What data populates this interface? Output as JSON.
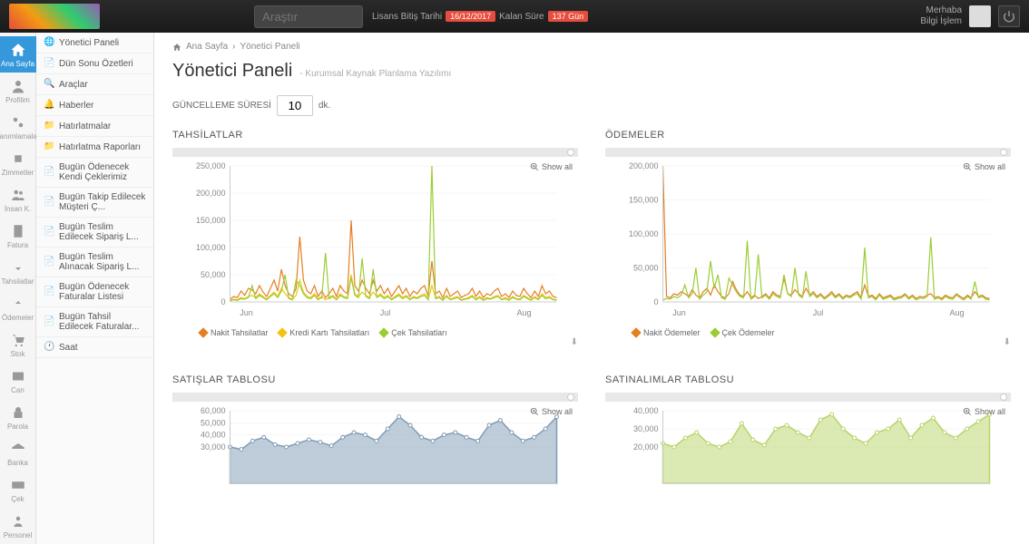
{
  "header": {
    "search_placeholder": "Araştır",
    "license_label": "Lisans Bitiş Tarihi",
    "license_date": "16/12/2017",
    "remaining_label": "Kalan Süre",
    "remaining_value": "137 Gün",
    "greeting": "Merhaba",
    "user_name": "Bilgi İşlem"
  },
  "icon_nav": [
    {
      "id": "home",
      "label": "Ana Sayfa"
    },
    {
      "id": "profile",
      "label": "Profilim"
    },
    {
      "id": "defs",
      "label": "Tanımlamalar"
    },
    {
      "id": "zimmet",
      "label": "Zimmetler"
    },
    {
      "id": "insan",
      "label": "İnsan K."
    },
    {
      "id": "fatura",
      "label": "Fatura"
    },
    {
      "id": "tahsilat",
      "label": "Tahsilatlar"
    },
    {
      "id": "odeme",
      "label": "Ödemeler"
    },
    {
      "id": "stok",
      "label": "Stok"
    },
    {
      "id": "can",
      "label": "Can"
    },
    {
      "id": "parola",
      "label": "Parola"
    },
    {
      "id": "banka",
      "label": "Banka"
    },
    {
      "id": "cek",
      "label": "Çek"
    },
    {
      "id": "personel",
      "label": "Personel"
    }
  ],
  "menu": [
    {
      "label": "Yönetici Paneli",
      "icon": "globe"
    },
    {
      "label": "Dün Sonu Özetleri",
      "icon": "doc"
    },
    {
      "label": "Araçlar",
      "icon": "search"
    },
    {
      "label": "Haberler",
      "icon": "bell"
    },
    {
      "label": "Hatırlatmalar",
      "icon": "folder"
    },
    {
      "label": "Hatırlatma Raporları",
      "icon": "folder"
    },
    {
      "label": "Bugün Ödenecek Kendi Çeklerimiz",
      "icon": "doc"
    },
    {
      "label": "Bugün Takip Edilecek Müşteri Ç...",
      "icon": "doc"
    },
    {
      "label": "Bugün Teslim Edilecek Sipariş L...",
      "icon": "doc"
    },
    {
      "label": "Bugün Teslim Alınacak Sipariş L...",
      "icon": "doc"
    },
    {
      "label": "Bugün Ödenecek Faturalar Listesi",
      "icon": "doc"
    },
    {
      "label": "Bugün Tahsil Edilecek Faturalar...",
      "icon": "doc"
    },
    {
      "label": "Saat",
      "icon": "clock"
    }
  ],
  "breadcrumb": {
    "home": "Ana Sayfa",
    "current": "Yönetici Paneli"
  },
  "page": {
    "title": "Yönetici Paneli",
    "subtitle": "- Kurumsal Kaynak Planlama Yazılımı"
  },
  "refresh": {
    "label": "GÜNCELLEME SÜRESİ",
    "value": "10",
    "unit": "dk."
  },
  "chart_titles": {
    "tahsilatlar": "TAHSİLATLAR",
    "odemeler": "ÖDEMELER",
    "satislar": "SATIŞLAR TABLOSU",
    "satinalim": "SATINALIMLAR TABLOSU"
  },
  "show_all": "Show all",
  "chart_data": [
    {
      "id": "tahsilatlar",
      "type": "line",
      "xlabel": "",
      "ylabel": "",
      "ylim": [
        0,
        250000
      ],
      "yticks": [
        0,
        50000,
        100000,
        150000,
        200000,
        250000
      ],
      "xticks": [
        "Jun",
        "Jul",
        "Aug"
      ],
      "x_count": 90,
      "series": [
        {
          "name": "Nakit Tahsilatlar",
          "color": "#e67e22",
          "values": [
            5000,
            10000,
            8000,
            20000,
            12000,
            25000,
            22000,
            15000,
            30000,
            18000,
            10000,
            25000,
            40000,
            20000,
            60000,
            30000,
            15000,
            10000,
            25000,
            120000,
            40000,
            20000,
            15000,
            30000,
            10000,
            20000,
            8000,
            15000,
            25000,
            10000,
            30000,
            20000,
            15000,
            150000,
            30000,
            20000,
            40000,
            25000,
            15000,
            40000,
            20000,
            30000,
            15000,
            25000,
            10000,
            20000,
            30000,
            15000,
            25000,
            10000,
            20000,
            15000,
            25000,
            30000,
            10000,
            75000,
            15000,
            20000,
            8000,
            25000,
            10000,
            15000,
            20000,
            8000,
            12000,
            15000,
            25000,
            10000,
            20000,
            8000,
            15000,
            12000,
            20000,
            25000,
            10000,
            15000,
            8000,
            20000,
            12000,
            10000,
            25000,
            15000,
            8000,
            20000,
            10000,
            30000,
            15000,
            20000,
            10000,
            8000
          ]
        },
        {
          "name": "Kredi Kartı Tahsilatları",
          "color": "#f1c40f",
          "values": [
            3000,
            5000,
            4000,
            8000,
            6000,
            10000,
            12000,
            8000,
            15000,
            10000,
            5000,
            12000,
            18000,
            10000,
            25000,
            15000,
            8000,
            5000,
            12000,
            40000,
            18000,
            10000,
            8000,
            15000,
            5000,
            10000,
            4000,
            8000,
            12000,
            5000,
            15000,
            10000,
            8000,
            50000,
            15000,
            10000,
            18000,
            12000,
            8000,
            18000,
            10000,
            15000,
            8000,
            12000,
            5000,
            10000,
            15000,
            8000,
            12000,
            5000,
            10000,
            8000,
            12000,
            15000,
            5000,
            30000,
            8000,
            10000,
            4000,
            12000,
            5000,
            8000,
            10000,
            4000,
            6000,
            8000,
            12000,
            5000,
            10000,
            4000,
            8000,
            6000,
            10000,
            12000,
            5000,
            8000,
            4000,
            10000,
            6000,
            5000,
            12000,
            8000,
            4000,
            10000,
            5000,
            15000,
            8000,
            10000,
            5000,
            4000
          ]
        },
        {
          "name": "Çek Tahsilatları",
          "color": "#9acd32",
          "values": [
            2000,
            4000,
            3000,
            6000,
            5000,
            8000,
            30000,
            6000,
            12000,
            8000,
            4000,
            10000,
            15000,
            8000,
            20000,
            50000,
            6000,
            4000,
            40000,
            30000,
            15000,
            8000,
            6000,
            12000,
            4000,
            8000,
            90000,
            6000,
            10000,
            4000,
            12000,
            8000,
            6000,
            45000,
            12000,
            8000,
            80000,
            10000,
            6000,
            60000,
            8000,
            12000,
            6000,
            10000,
            4000,
            8000,
            12000,
            6000,
            10000,
            4000,
            8000,
            6000,
            10000,
            12000,
            4000,
            250000,
            6000,
            8000,
            3000,
            10000,
            4000,
            6000,
            8000,
            3000,
            5000,
            6000,
            10000,
            4000,
            8000,
            3000,
            6000,
            5000,
            8000,
            10000,
            4000,
            6000,
            3000,
            8000,
            5000,
            4000,
            10000,
            6000,
            3000,
            8000,
            4000,
            12000,
            6000,
            8000,
            4000,
            3000
          ]
        }
      ]
    },
    {
      "id": "odemeler",
      "type": "line",
      "xlabel": "",
      "ylabel": "",
      "ylim": [
        0,
        200000
      ],
      "yticks": [
        0,
        50000,
        100000,
        150000,
        200000
      ],
      "xticks": [
        "Jun",
        "Jul",
        "Aug"
      ],
      "x_count": 90,
      "series": [
        {
          "name": "Nakit Ödemeler",
          "color": "#e67e22",
          "values": [
            200000,
            8000,
            6000,
            12000,
            10000,
            15000,
            12000,
            8000,
            18000,
            10000,
            6000,
            15000,
            20000,
            10000,
            25000,
            15000,
            8000,
            6000,
            12000,
            30000,
            18000,
            10000,
            8000,
            15000,
            6000,
            10000,
            5000,
            8000,
            12000,
            6000,
            15000,
            10000,
            8000,
            35000,
            12000,
            10000,
            18000,
            12000,
            8000,
            20000,
            10000,
            15000,
            8000,
            12000,
            6000,
            10000,
            15000,
            8000,
            12000,
            6000,
            10000,
            8000,
            12000,
            15000,
            6000,
            25000,
            8000,
            10000,
            5000,
            12000,
            6000,
            8000,
            10000,
            5000,
            7000,
            8000,
            12000,
            6000,
            10000,
            5000,
            8000,
            7000,
            10000,
            12000,
            6000,
            8000,
            5000,
            10000,
            7000,
            6000,
            12000,
            8000,
            5000,
            10000,
            6000,
            15000,
            8000,
            10000,
            6000,
            5000
          ]
        },
        {
          "name": "Çek Ödemeler",
          "color": "#9acd32",
          "values": [
            3000,
            5000,
            4000,
            8000,
            6000,
            10000,
            25000,
            6000,
            12000,
            50000,
            4000,
            10000,
            15000,
            60000,
            20000,
            40000,
            6000,
            4000,
            35000,
            25000,
            15000,
            8000,
            6000,
            90000,
            4000,
            8000,
            70000,
            6000,
            10000,
            4000,
            12000,
            8000,
            6000,
            40000,
            12000,
            8000,
            50000,
            10000,
            6000,
            45000,
            8000,
            12000,
            6000,
            10000,
            4000,
            8000,
            12000,
            6000,
            10000,
            4000,
            8000,
            6000,
            10000,
            12000,
            4000,
            80000,
            6000,
            8000,
            3000,
            10000,
            4000,
            6000,
            8000,
            3000,
            5000,
            6000,
            10000,
            4000,
            8000,
            3000,
            6000,
            5000,
            8000,
            95000,
            4000,
            6000,
            3000,
            8000,
            5000,
            4000,
            10000,
            6000,
            3000,
            8000,
            4000,
            30000,
            6000,
            8000,
            4000,
            3000
          ]
        }
      ]
    },
    {
      "id": "satislar",
      "type": "area",
      "ylim": [
        0,
        60000
      ],
      "yticks": [
        30000,
        40000,
        50000,
        60000
      ],
      "x_count": 30,
      "series": [
        {
          "name": "Satışlar",
          "color": "#7f9bb5",
          "values": [
            30000,
            28000,
            35000,
            38000,
            32000,
            30000,
            33000,
            36000,
            34000,
            31000,
            38000,
            42000,
            40000,
            35000,
            45000,
            55000,
            48000,
            38000,
            35000,
            40000,
            42000,
            38000,
            35000,
            48000,
            52000,
            42000,
            35000,
            38000,
            45000,
            55000
          ]
        }
      ]
    },
    {
      "id": "satinalim",
      "type": "area",
      "ylim": [
        0,
        40000
      ],
      "yticks": [
        20000,
        30000,
        40000
      ],
      "x_count": 30,
      "series": [
        {
          "name": "Satınalımlar",
          "color": "#b8d468",
          "values": [
            22000,
            20000,
            25000,
            28000,
            22000,
            20000,
            23000,
            33000,
            24000,
            21000,
            30000,
            32000,
            28000,
            25000,
            35000,
            38000,
            30000,
            25000,
            22000,
            28000,
            30000,
            35000,
            25000,
            32000,
            36000,
            28000,
            25000,
            30000,
            34000,
            38000
          ]
        }
      ]
    }
  ]
}
